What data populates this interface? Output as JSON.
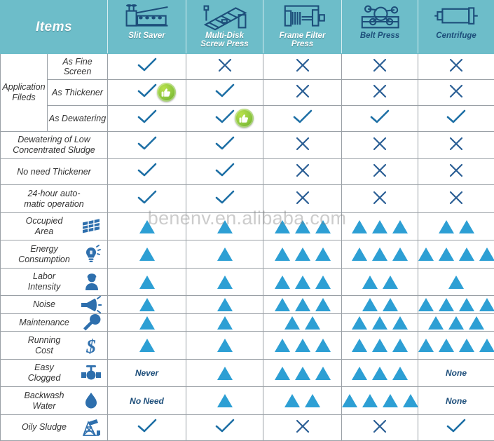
{
  "header": {
    "items_label": "Items",
    "products": [
      {
        "name": "Slit Saver",
        "icon": "slit-saver-icon",
        "style": "light"
      },
      {
        "name": "Multi-Disk\nScrew Press",
        "icon": "multi-disk-screw-press-icon",
        "style": "light"
      },
      {
        "name": "Frame Filter\nPress",
        "icon": "frame-filter-press-icon",
        "style": "light"
      },
      {
        "name": "Belt Press",
        "icon": "belt-press-icon",
        "style": "dark"
      },
      {
        "name": "Centrifuge",
        "icon": "centrifuge-icon",
        "style": "dark"
      }
    ]
  },
  "group": {
    "application_fields": "Application\nFileds"
  },
  "rows": [
    {
      "label": "As Fine Screen",
      "icon": null,
      "values": [
        {
          "t": "check"
        },
        {
          "t": "cross"
        },
        {
          "t": "cross"
        },
        {
          "t": "cross"
        },
        {
          "t": "cross"
        }
      ]
    },
    {
      "label": "As Thickener",
      "icon": null,
      "values": [
        {
          "t": "check",
          "badge": "thumbs-up"
        },
        {
          "t": "check"
        },
        {
          "t": "cross"
        },
        {
          "t": "cross"
        },
        {
          "t": "cross"
        }
      ]
    },
    {
      "label": "As Dewatering",
      "icon": null,
      "values": [
        {
          "t": "check"
        },
        {
          "t": "check",
          "badge": "thumbs-up"
        },
        {
          "t": "check"
        },
        {
          "t": "check"
        },
        {
          "t": "check"
        }
      ]
    },
    {
      "label": "Dewatering of Low\nConcentrated Sludge",
      "icon": null,
      "values": [
        {
          "t": "check"
        },
        {
          "t": "check"
        },
        {
          "t": "cross"
        },
        {
          "t": "cross"
        },
        {
          "t": "cross"
        }
      ]
    },
    {
      "label": "No need Thickener",
      "icon": null,
      "values": [
        {
          "t": "check"
        },
        {
          "t": "check"
        },
        {
          "t": "cross"
        },
        {
          "t": "cross"
        },
        {
          "t": "cross"
        }
      ]
    },
    {
      "label": "24-hour auto-\nmatic operation",
      "icon": null,
      "values": [
        {
          "t": "check"
        },
        {
          "t": "check"
        },
        {
          "t": "cross"
        },
        {
          "t": "cross"
        },
        {
          "t": "cross"
        }
      ]
    },
    {
      "label": "Occupied\nArea",
      "icon": "area-grid-icon",
      "values": [
        {
          "t": "tri",
          "n": 1
        },
        {
          "t": "tri",
          "n": 1
        },
        {
          "t": "tri",
          "n": 3
        },
        {
          "t": "tri",
          "n": 3
        },
        {
          "t": "tri",
          "n": 2
        }
      ]
    },
    {
      "label": "Energy\nConsumption",
      "icon": "lightbulb-icon",
      "values": [
        {
          "t": "tri",
          "n": 1
        },
        {
          "t": "tri",
          "n": 1
        },
        {
          "t": "tri",
          "n": 3
        },
        {
          "t": "tri",
          "n": 3
        },
        {
          "t": "tri",
          "n": 4
        }
      ]
    },
    {
      "label": "Labor\nIntensity",
      "icon": "worker-icon",
      "values": [
        {
          "t": "tri",
          "n": 1
        },
        {
          "t": "tri",
          "n": 1
        },
        {
          "t": "tri",
          "n": 3
        },
        {
          "t": "tri",
          "n": 2
        },
        {
          "t": "tri",
          "n": 1
        }
      ]
    },
    {
      "label": "Noise",
      "icon": "megaphone-icon",
      "values": [
        {
          "t": "tri",
          "n": 1
        },
        {
          "t": "tri",
          "n": 1
        },
        {
          "t": "tri",
          "n": 3
        },
        {
          "t": "tri",
          "n": 2
        },
        {
          "t": "tri",
          "n": 4
        }
      ]
    },
    {
      "label": "Maintenance",
      "icon": "wrench-icon",
      "values": [
        {
          "t": "tri",
          "n": 1
        },
        {
          "t": "tri",
          "n": 1
        },
        {
          "t": "tri",
          "n": 2
        },
        {
          "t": "tri",
          "n": 3
        },
        {
          "t": "tri",
          "n": 3
        }
      ]
    },
    {
      "label": "Running\nCost",
      "icon": "dollar-icon",
      "values": [
        {
          "t": "tri",
          "n": 1
        },
        {
          "t": "tri",
          "n": 1
        },
        {
          "t": "tri",
          "n": 3
        },
        {
          "t": "tri",
          "n": 3
        },
        {
          "t": "tri",
          "n": 4
        }
      ]
    },
    {
      "label": "Easy\nClogged",
      "icon": "valve-icon",
      "values": [
        {
          "t": "text",
          "v": "Never"
        },
        {
          "t": "tri",
          "n": 1
        },
        {
          "t": "tri",
          "n": 3
        },
        {
          "t": "tri",
          "n": 3
        },
        {
          "t": "text",
          "v": "None"
        }
      ]
    },
    {
      "label": "Backwash\nWater",
      "icon": "water-drop-icon",
      "values": [
        {
          "t": "text",
          "v": "No Need"
        },
        {
          "t": "tri",
          "n": 1
        },
        {
          "t": "tri",
          "n": 2
        },
        {
          "t": "tri",
          "n": 4
        },
        {
          "t": "text",
          "v": "None"
        }
      ]
    },
    {
      "label": "Oily Sludge",
      "icon": "oil-pump-icon",
      "values": [
        {
          "t": "check"
        },
        {
          "t": "check"
        },
        {
          "t": "cross"
        },
        {
          "t": "cross"
        },
        {
          "t": "check"
        }
      ]
    }
  ],
  "watermark": "benenv.en.alibaba.com",
  "colors": {
    "header_teal": "#6dbdc9",
    "highlight_yellow": "#f4eea4",
    "triangle_blue": "#2d9fd4",
    "check_blue": "#1d6fa5",
    "text_dark_blue": "#1d4e7a",
    "badge_green": "#8cc63f"
  }
}
